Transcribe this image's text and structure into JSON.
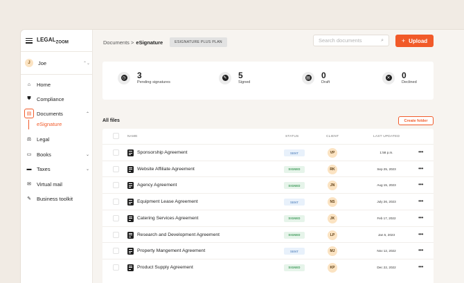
{
  "sidebar": {
    "logo": {
      "a": "LEGAL",
      "b": "ZOOM"
    },
    "user": {
      "initial": "J",
      "name": "Joe",
      "chevron": "⌃⌄"
    },
    "items": [
      {
        "label": "Home",
        "icon": "home-icon",
        "glyph": "⌂"
      },
      {
        "label": "Compliance",
        "icon": "shield-icon",
        "glyph": "⛊"
      },
      {
        "label": "Documents",
        "icon": "document-icon",
        "glyph": "▤",
        "expanded": true
      },
      {
        "label": "Legal",
        "icon": "scale-icon",
        "glyph": "⚖"
      },
      {
        "label": "Books",
        "icon": "book-icon",
        "glyph": "▭"
      },
      {
        "label": "Taxes",
        "icon": "tax-icon",
        "glyph": "▬"
      },
      {
        "label": "Virtual mail",
        "icon": "mail-icon",
        "glyph": "✉"
      },
      {
        "label": "Business toolkit",
        "icon": "wrench-icon",
        "glyph": "✎"
      }
    ],
    "sub_item": "eSignature"
  },
  "header": {
    "crumb_parent": "Documents >",
    "crumb_current": "eSignature",
    "plan_badge": "ESIGNATURE PLUS PLAN",
    "search_placeholder": "Search documents",
    "upload_label": "Upload",
    "upload_plus": "+"
  },
  "stats": [
    {
      "num": "3",
      "label": "Pending signatures",
      "icon": "clock-icon",
      "glyph": "◷"
    },
    {
      "num": "5",
      "label": "Signed",
      "icon": "pen-icon",
      "glyph": "✎"
    },
    {
      "num": "0",
      "label": "Draft",
      "icon": "draft-icon",
      "glyph": "▤"
    },
    {
      "num": "0",
      "label": "Declined",
      "icon": "declined-icon",
      "glyph": "✕"
    }
  ],
  "files": {
    "title": "All files",
    "create_folder": "Create folder",
    "columns": {
      "name": "NAME",
      "status": "STATUS",
      "client": "CLIENT",
      "updated": "LAST UPDATED"
    },
    "rows": [
      {
        "name": "Sponsorship Agreement",
        "status": "SENT",
        "client": "VP",
        "date": "1:58 p.m."
      },
      {
        "name": "Website Affiliate Agreement",
        "status": "SIGNED",
        "client": "RK",
        "date": "Sep 25, 2023"
      },
      {
        "name": "Agency Agreement",
        "status": "SIGNED",
        "client": "JN",
        "date": "Aug 15, 2023"
      },
      {
        "name": "Equipment Lease Agreement",
        "status": "SENT",
        "client": "NS",
        "date": "July 26, 2023"
      },
      {
        "name": "Catering Services Agreement",
        "status": "SIGNED",
        "client": "JK",
        "date": "Feb 17, 2022"
      },
      {
        "name": "Research and Development Agreement",
        "status": "SIGNED",
        "client": "LP",
        "date": "Jan 5, 2023"
      },
      {
        "name": "Property Mangement Agreement",
        "status": "SENT",
        "client": "MJ",
        "date": "Nov 12, 2022"
      },
      {
        "name": "Product Supply Agreement",
        "status": "SIGNED",
        "client": "KP",
        "date": "Dec 22, 2022"
      }
    ]
  },
  "colors": {
    "accent": "#f15a29",
    "sent_bg": "#e8f1fb",
    "signed_bg": "#e6f4ea",
    "avatar_bg": "#fbe3c2"
  }
}
